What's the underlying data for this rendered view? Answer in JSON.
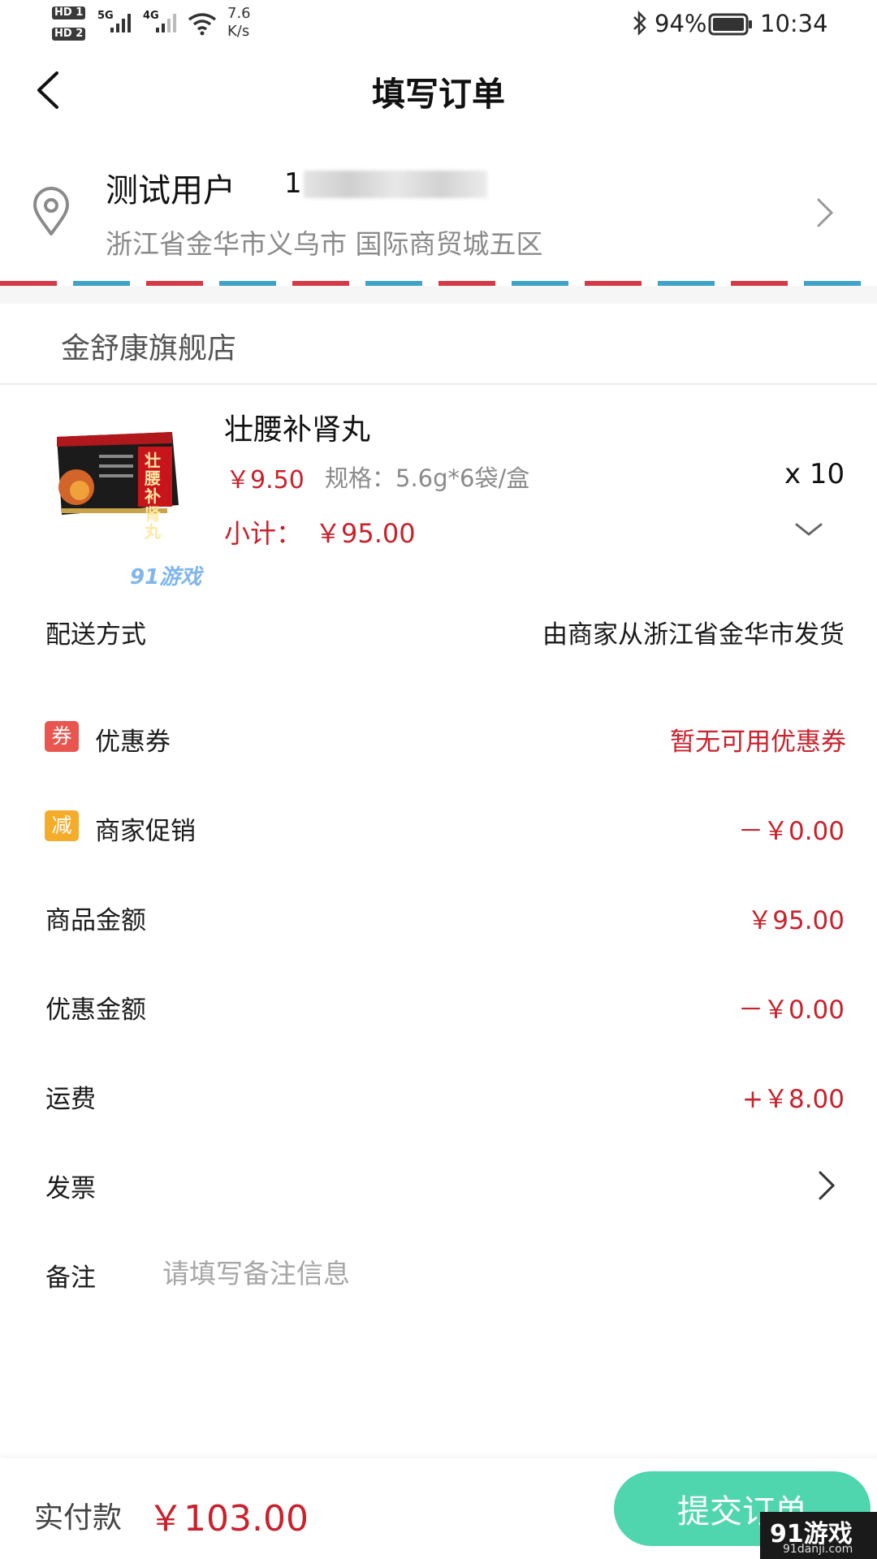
{
  "status_bar": {
    "sim1": "HD 1",
    "sim2": "HD 2",
    "net1": "5G",
    "net2": "4G",
    "speed_value": "7.6",
    "speed_unit": "K/s",
    "battery": "94%",
    "time": "10:34"
  },
  "header": {
    "title": "填写订单"
  },
  "address": {
    "name": "测试用户",
    "phone": "1",
    "detail": "浙江省金华市义乌市 国际商贸城五区"
  },
  "shop": {
    "name": "金舒康旗舰店"
  },
  "product": {
    "title": "壮腰补肾丸",
    "price": "￥9.50",
    "spec": "规格：5.6g*6袋/盒",
    "quantity": "x 10",
    "subtotal_label": "小计：",
    "subtotal_value": "￥95.00",
    "box_text": "壮腰补肾丸"
  },
  "watermark_top": "91游戏",
  "rows": {
    "shipping": {
      "label": "配送方式",
      "value": "由商家从浙江省金华市发货"
    },
    "coupon": {
      "badge": "券",
      "label": "优惠券",
      "value": "暂无可用优惠券"
    },
    "promo": {
      "badge": "减",
      "label": "商家促销",
      "value": "－￥0.00"
    },
    "goods_amount": {
      "label": "商品金额",
      "value": "￥95.00"
    },
    "discount_amount": {
      "label": "优惠金额",
      "value": "－￥0.00"
    },
    "freight": {
      "label": "运费",
      "value": "+￥8.00"
    },
    "invoice": {
      "label": "发票"
    },
    "note": {
      "label": "备注",
      "placeholder": "请填写备注信息"
    }
  },
  "footer": {
    "pay_label": "实付款",
    "pay_amount": "￥103.00",
    "submit_label": "提交订单"
  },
  "watermark_bottom": {
    "logo": "91游戏",
    "url": "91danji.com"
  },
  "colors": {
    "accent_red": "#c9222c",
    "submit_green": "#4fd6ae",
    "coupon_badge": "#e9564f",
    "promo_badge": "#f5ac2a",
    "envelope_red": "#d33a45",
    "envelope_blue": "#3fa2c7"
  }
}
